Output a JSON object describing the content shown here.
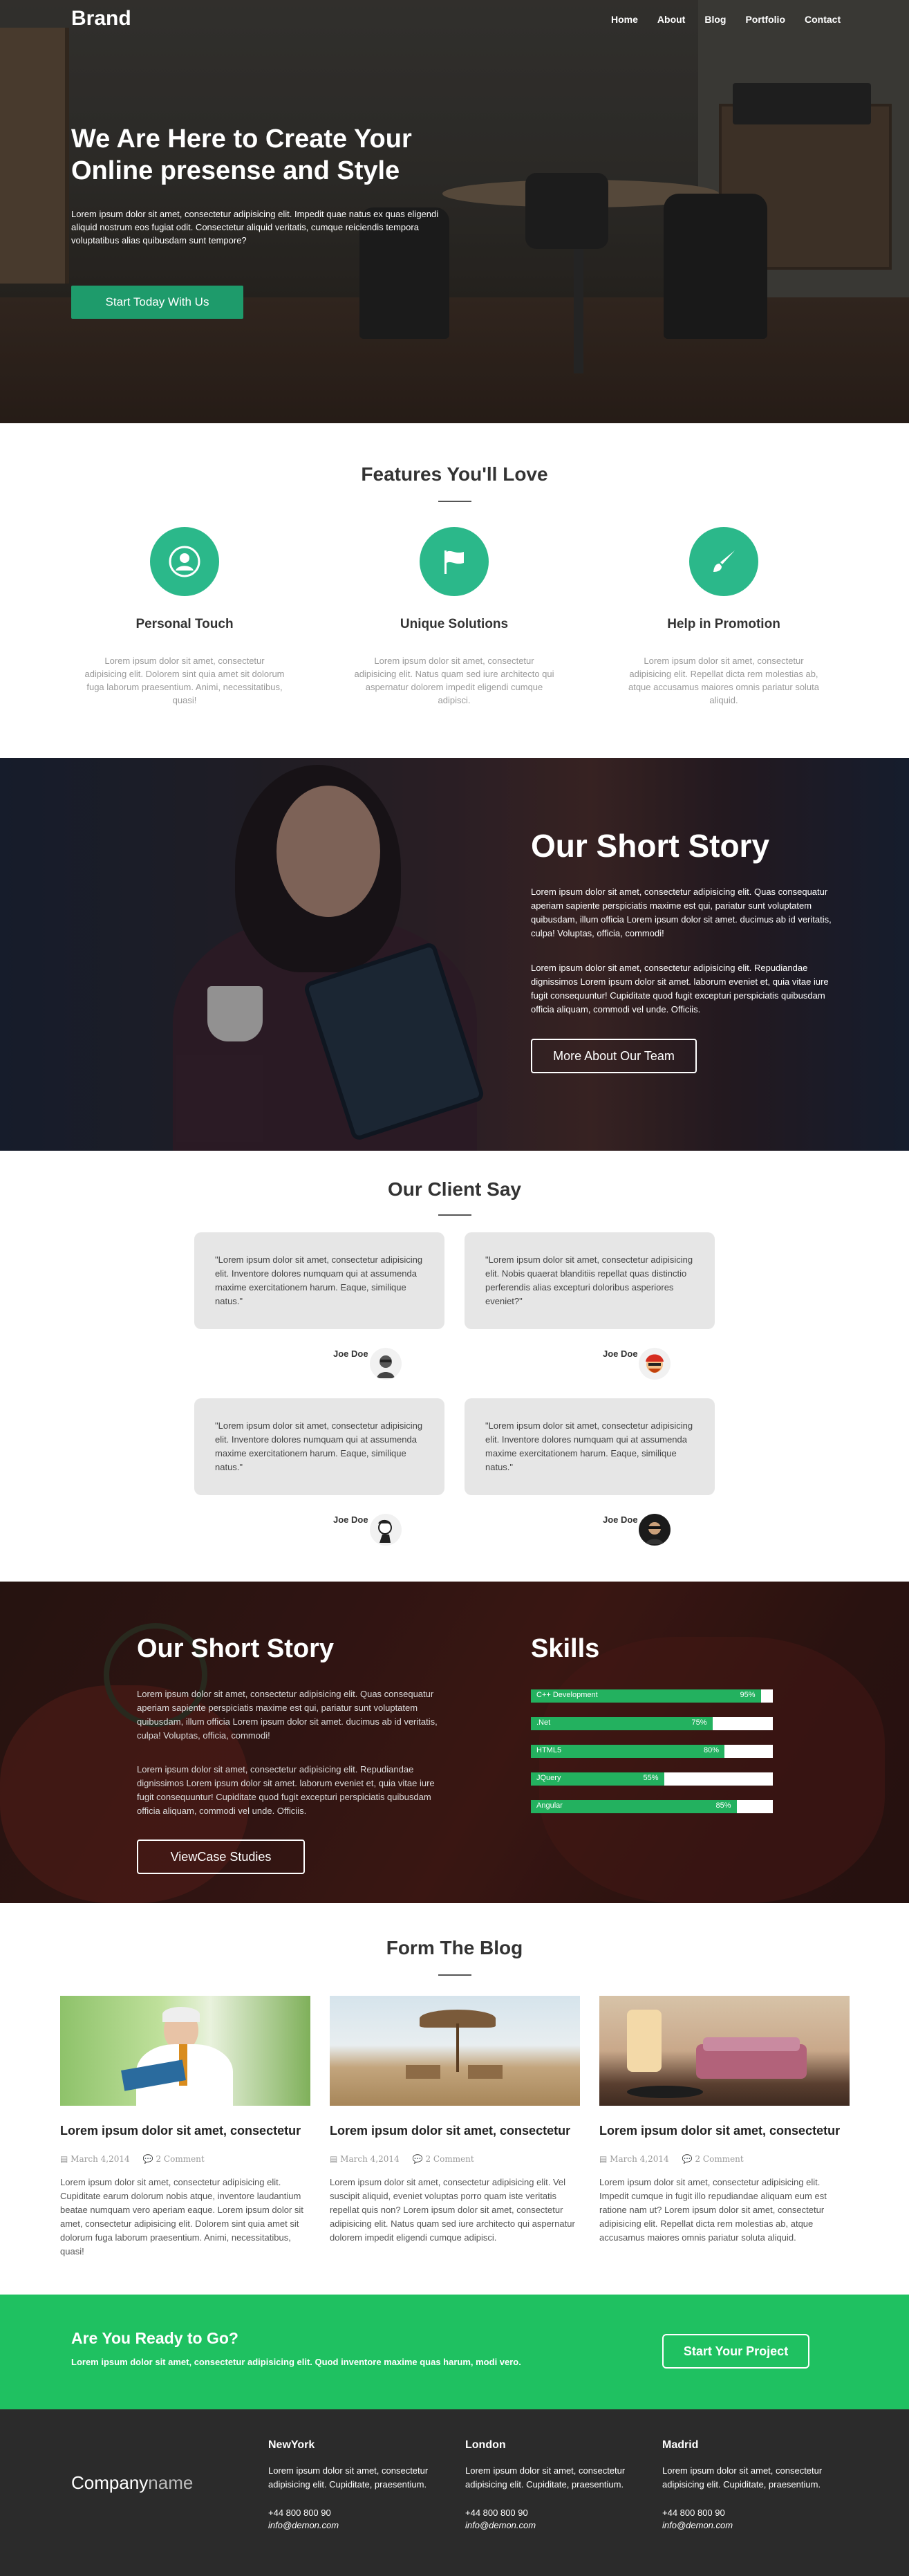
{
  "header": {
    "brand": "Brand",
    "nav": [
      "Home",
      "About",
      "Blog",
      "Portfolio",
      "Contact"
    ]
  },
  "hero": {
    "title": "We Are Here to Create Your Online presense and Style",
    "text": "Lorem ipsum dolor sit amet, consectetur adipisicing elit. Impedit quae natus ex quas eligendi aliquid nostrum eos fugiat odit. Consectetur aliquid veritatis, cumque reiciendis tempora voluptatibus alias quibusdam sunt tempore?",
    "button": "Start Today With Us"
  },
  "features": {
    "title": "Features You'll Love",
    "items": [
      {
        "icon": "user-icon",
        "title": "Personal Touch",
        "text": "Lorem ipsum dolor sit amet, consectetur adipisicing elit. Dolorem sint quia amet sit dolorum fuga laborum praesentium. Animi, necessitatibus, quasi!"
      },
      {
        "icon": "flag-icon",
        "title": "Unique Solutions",
        "text": "Lorem ipsum dolor sit amet, consectetur adipisicing elit. Natus quam sed iure architecto qui aspernatur dolorem impedit eligendi cumque adipisci."
      },
      {
        "icon": "paintbrush-icon",
        "title": "Help in Promotion",
        "text": "Lorem ipsum dolor sit amet, consectetur adipisicing elit. Repellat dicta rem molestias ab, atque accusamus maiores omnis pariatur soluta aliquid."
      }
    ]
  },
  "story": {
    "title": "Our Short Story",
    "p1": "Lorem ipsum dolor sit amet, consectetur adipisicing elit. Quas consequatur aperiam sapiente perspiciatis maxime est qui, pariatur sunt voluptatem quibusdam, illum officia Lorem ipsum dolor sit amet. ducimus ab id veritatis, culpa! Voluptas, officia, commodi!",
    "p2": "Lorem ipsum dolor sit amet, consectetur adipisicing elit. Repudiandae dignissimos Lorem ipsum dolor sit amet. laborum eveniet et, quia vitae iure fugit consequuntur! Cupiditate quod fugit excepturi perspiciatis quibusdam officia aliquam, commodi vel unde. Officiis.",
    "button": "More About Our Team"
  },
  "clients": {
    "title": "Our Client Say",
    "items": [
      {
        "quote": "\"Lorem ipsum dolor sit amet, consectetur adipisicing elit. Inventore dolores numquam qui at assumenda maxime exercitationem harum. Eaque, similique natus.\"",
        "author": "Joe Doe"
      },
      {
        "quote": "\"Lorem ipsum dolor sit amet, consectetur adipisicing elit. Nobis quaerat blanditiis repellat quas distinctio perferendis alias excepturi doloribus asperiores eveniet?\"",
        "author": "Joe Doe"
      },
      {
        "quote": "\"Lorem ipsum dolor sit amet, consectetur adipisicing elit. Inventore dolores numquam qui at assumenda maxime exercitationem harum. Eaque, similique natus.\"",
        "author": "Joe Doe"
      },
      {
        "quote": "\"Lorem ipsum dolor sit amet, consectetur adipisicing elit. Inventore dolores numquam qui at assumenda maxime exercitationem harum. Eaque, similique natus.\"",
        "author": "Joe Doe"
      }
    ]
  },
  "story2": {
    "title": "Our Short Story",
    "p1": "Lorem ipsum dolor sit amet, consectetur adipisicing elit. Quas consequatur aperiam sapiente perspiciatis maxime est qui, pariatur sunt voluptatem quibusdam, illum officia Lorem ipsum dolor sit amet. ducimus ab id veritatis, culpa! Voluptas, officia, commodi!",
    "p2": "Lorem ipsum dolor sit amet, consectetur adipisicing elit. Repudiandae dignissimos Lorem ipsum dolor sit amet. laborum eveniet et, quia vitae iure fugit consequuntur! Cupiditate quod fugit excepturi perspiciatis quibusdam officia aliquam, commodi vel unde. Officiis.",
    "button": "ViewCase Studies"
  },
  "skills": {
    "title": "Skills",
    "items": [
      {
        "name": "C++ Development",
        "value": 95,
        "label": "95%"
      },
      {
        "name": ".Net",
        "value": 75,
        "label": "75%"
      },
      {
        "name": "HTML5",
        "value": 80,
        "label": "80%"
      },
      {
        "name": "JQuery",
        "value": 55,
        "label": "55%"
      },
      {
        "name": "Angular",
        "value": 85,
        "label": "85%"
      }
    ],
    "fill_color": "#23b15f"
  },
  "blog": {
    "title": "Form The Blog",
    "posts": [
      {
        "title": "Lorem ipsum dolor sit amet, consectetur",
        "date": "March 4,2014",
        "comments": "2 Comment",
        "text": "Lorem ipsum dolor sit amet, consectetur adipisicing elit. Cupiditate earum dolorum nobis atque, inventore laudantium beatae numquam vero aperiam eaque. Lorem ipsum dolor sit amet, consectetur adipisicing elit. Dolorem sint quia amet sit dolorum fuga laborum praesentium. Animi, necessitatibus, quasi!"
      },
      {
        "title": "Lorem ipsum dolor sit amet, consectetur",
        "date": "March 4,2014",
        "comments": "2 Comment",
        "text": "Lorem ipsum dolor sit amet, consectetur adipisicing elit. Vel suscipit aliquid, eveniet voluptas porro quam iste veritatis repellat quis non? Lorem ipsum dolor sit amet, consectetur adipisicing elit. Natus quam sed iure architecto qui aspernatur dolorem impedit eligendi cumque adipisci."
      },
      {
        "title": "Lorem ipsum dolor sit amet, consectetur",
        "date": "March 4,2014",
        "comments": "2 Comment",
        "text": "Lorem ipsum dolor sit amet, consectetur adipisicing elit. Impedit cumque in fugit illo repudiandae aliquam eum est ratione nam ut? Lorem ipsum dolor sit amet, consectetur adipisicing elit. Repellat dicta rem molestias ab, atque accusamus maiores omnis pariatur soluta aliquid."
      }
    ]
  },
  "cta": {
    "title": "Are You Ready to Go?",
    "text": "Lorem ipsum dolor sit amet, consectetur adipisicing elit. Quod inventore maxime quas harum, modi vero.",
    "button": "Start Your Project",
    "color": "#1fc161"
  },
  "footer": {
    "logo_main": "Company",
    "logo_light": "name",
    "cols": [
      {
        "city": "NewYork",
        "text": "Lorem ipsum dolor sit amet, consectetur adipisicing elit. Cupiditate, praesentium.",
        "phone": "+44 800 800 90",
        "email": "info@demon.com"
      },
      {
        "city": "London",
        "text": "Lorem ipsum dolor sit amet, consectetur adipisicing elit. Cupiditate, praesentium.",
        "phone": "+44 800 800 90",
        "email": "info@demon.com"
      },
      {
        "city": "Madrid",
        "text": "Lorem ipsum dolor sit amet, consectetur adipisicing elit. Cupiditate, praesentium.",
        "phone": "+44 800 800 90",
        "email": "info@demon.com"
      }
    ]
  },
  "colors": {
    "accent": "#2bb88a",
    "hero_button": "#1e9b6b",
    "footer_bg": "#2b2b2b"
  }
}
